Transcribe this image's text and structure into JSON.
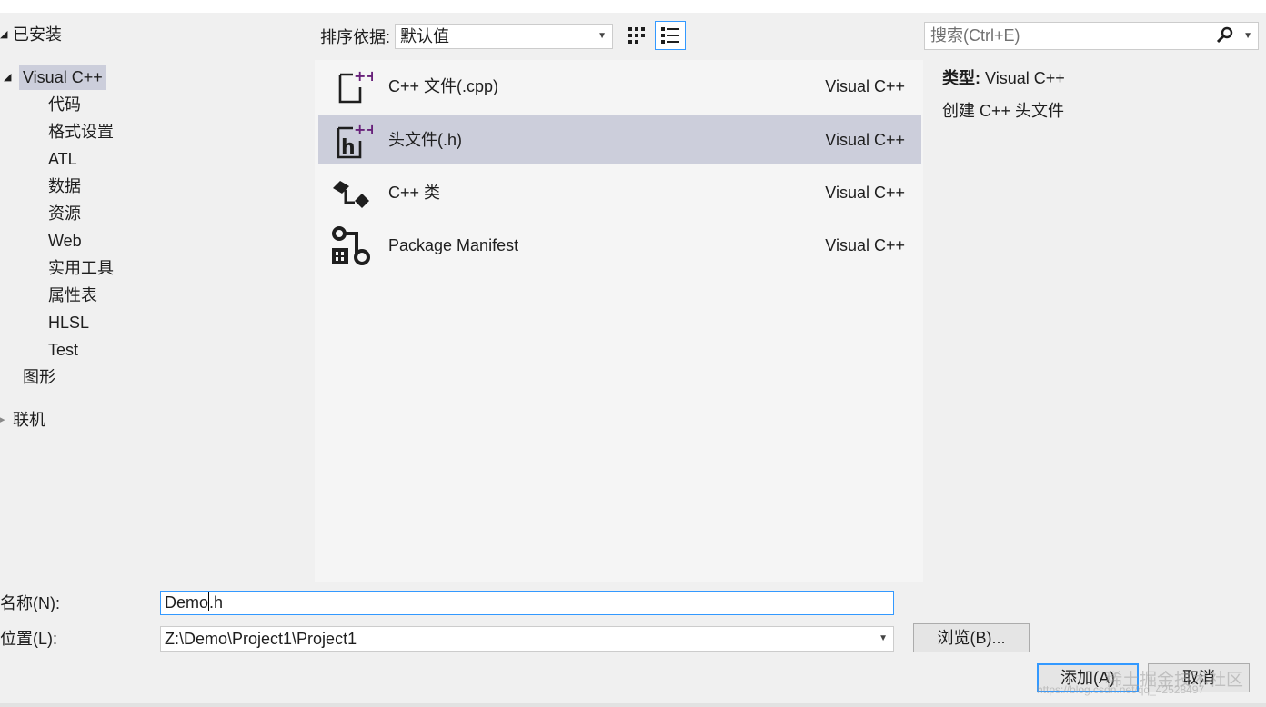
{
  "tree": {
    "installed": "已安装",
    "visual_cpp": "Visual C++",
    "children": [
      "代码",
      "格式设置",
      "ATL",
      "数据",
      "资源",
      "Web",
      "实用工具",
      "属性表",
      "HLSL",
      "Test"
    ],
    "graphics": "图形",
    "online": "联机"
  },
  "toolbar": {
    "sort_label": "排序依据:",
    "sort_value": "默认值",
    "search_placeholder": "搜索(Ctrl+E)"
  },
  "templates": [
    {
      "name": "C++ 文件(.cpp)",
      "lang": "Visual C++",
      "icon": "cpp-file-icon"
    },
    {
      "name": "头文件(.h)",
      "lang": "Visual C++",
      "icon": "header-file-icon",
      "selected": true
    },
    {
      "name": "C++ 类",
      "lang": "Visual C++",
      "icon": "cpp-class-icon"
    },
    {
      "name": "Package Manifest",
      "lang": "Visual C++",
      "icon": "package-manifest-icon"
    }
  ],
  "info": {
    "type_label": "类型:",
    "type_value": "Visual C++",
    "description": "创建 C++ 头文件"
  },
  "form": {
    "name_label": "名称(N):",
    "name_value_a": "Demo",
    "name_value_b": ".h",
    "location_label": "位置(L):",
    "location_value": "Z:\\Demo\\Project1\\Project1",
    "browse_label": "浏览(B)...",
    "add_label": "添加(A)",
    "cancel_label": "取消"
  },
  "watermark": {
    "line1": "稀土掘金技术社区",
    "line2": "https://blog.csdn.net/qq_42528497"
  },
  "colors": {
    "selection": "#cccedb",
    "focus": "#3399ff",
    "icon_purple": "#68217a"
  }
}
